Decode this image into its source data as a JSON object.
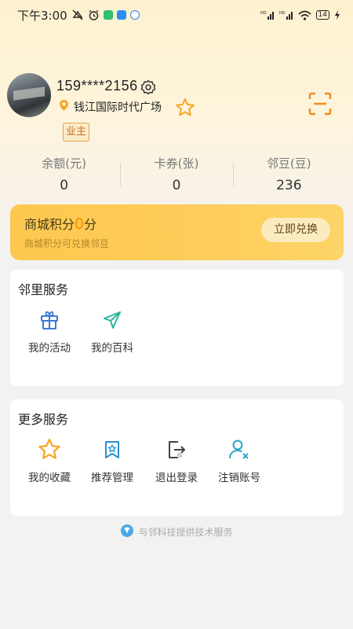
{
  "status_bar": {
    "time": "下午3:00",
    "battery": "14"
  },
  "profile": {
    "phone": "159****2156",
    "location": "钱江国际时代广场",
    "badge": "业主"
  },
  "stats": [
    {
      "label": "余额(元)",
      "value": "0"
    },
    {
      "label": "卡券(张)",
      "value": "0"
    },
    {
      "label": "邻豆(豆)",
      "value": "236"
    }
  ],
  "points": {
    "title_prefix": "商城积分",
    "value": "0",
    "title_suffix": "分",
    "subtitle": "商城积分可兑换邻豆",
    "button": "立即兑换"
  },
  "neighbor_services": {
    "title": "邻里服务",
    "items": [
      {
        "label": "我的活动",
        "icon": "gift-icon"
      },
      {
        "label": "我的百科",
        "icon": "paper-plane-icon"
      }
    ]
  },
  "more_services": {
    "title": "更多服务",
    "items": [
      {
        "label": "我的收藏",
        "icon": "star-icon"
      },
      {
        "label": "推荐管理",
        "icon": "bookmark-star-icon"
      },
      {
        "label": "退出登录",
        "icon": "logout-icon"
      },
      {
        "label": "注销账号",
        "icon": "user-remove-icon"
      }
    ]
  },
  "footer": {
    "text": "与邻科技提供技术服务"
  },
  "colors": {
    "accent": "#f5a623",
    "points_card": "#fdc84f",
    "points_number": "#ff8a00",
    "blue_icon": "#3a7bd5",
    "green_icon": "#2bb59b"
  }
}
